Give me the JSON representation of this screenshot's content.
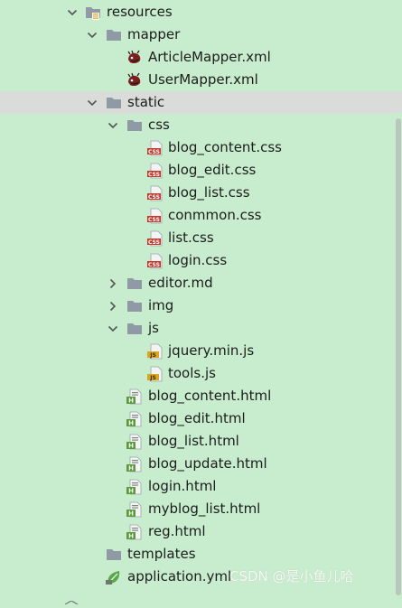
{
  "colors": {
    "background": "#c8edce",
    "selected_row": "#d9dcd8",
    "folder": "#8f9aa5",
    "css_badge": "#c0392b",
    "js_badge": "#d9a61c",
    "html_badge": "#5a9a3a",
    "xml_icon": "#7a1e1e"
  },
  "tree": {
    "items": [
      {
        "label": "resources",
        "icon": "resources-folder-icon",
        "expanded": true
      },
      {
        "label": "mapper",
        "icon": "folder-icon",
        "expanded": true
      },
      {
        "label": "ArticleMapper.xml",
        "icon": "mybatis-xml-icon"
      },
      {
        "label": "UserMapper.xml",
        "icon": "mybatis-xml-icon"
      },
      {
        "label": "static",
        "icon": "folder-icon",
        "expanded": true,
        "selected": true
      },
      {
        "label": "css",
        "icon": "folder-icon",
        "expanded": true
      },
      {
        "label": "blog_content.css",
        "icon": "css-file-icon"
      },
      {
        "label": "blog_edit.css",
        "icon": "css-file-icon"
      },
      {
        "label": "blog_list.css",
        "icon": "css-file-icon"
      },
      {
        "label": "conmmon.css",
        "icon": "css-file-icon"
      },
      {
        "label": "list.css",
        "icon": "css-file-icon"
      },
      {
        "label": "login.css",
        "icon": "css-file-icon"
      },
      {
        "label": "editor.md",
        "icon": "folder-icon",
        "expanded": false
      },
      {
        "label": "img",
        "icon": "folder-icon",
        "expanded": false
      },
      {
        "label": "js",
        "icon": "folder-icon",
        "expanded": true
      },
      {
        "label": "jquery.min.js",
        "icon": "js-file-icon"
      },
      {
        "label": "tools.js",
        "icon": "js-file-icon"
      },
      {
        "label": "blog_content.html",
        "icon": "html-file-icon"
      },
      {
        "label": "blog_edit.html",
        "icon": "html-file-icon"
      },
      {
        "label": "blog_list.html",
        "icon": "html-file-icon"
      },
      {
        "label": "blog_update.html",
        "icon": "html-file-icon"
      },
      {
        "label": "login.html",
        "icon": "html-file-icon"
      },
      {
        "label": "myblog_list.html",
        "icon": "html-file-icon"
      },
      {
        "label": "reg.html",
        "icon": "html-file-icon"
      },
      {
        "label": "templates",
        "icon": "folder-icon"
      },
      {
        "label": "application.yml",
        "icon": "spring-yml-icon"
      }
    ]
  },
  "watermark": "CSDN @是小鱼儿哈"
}
